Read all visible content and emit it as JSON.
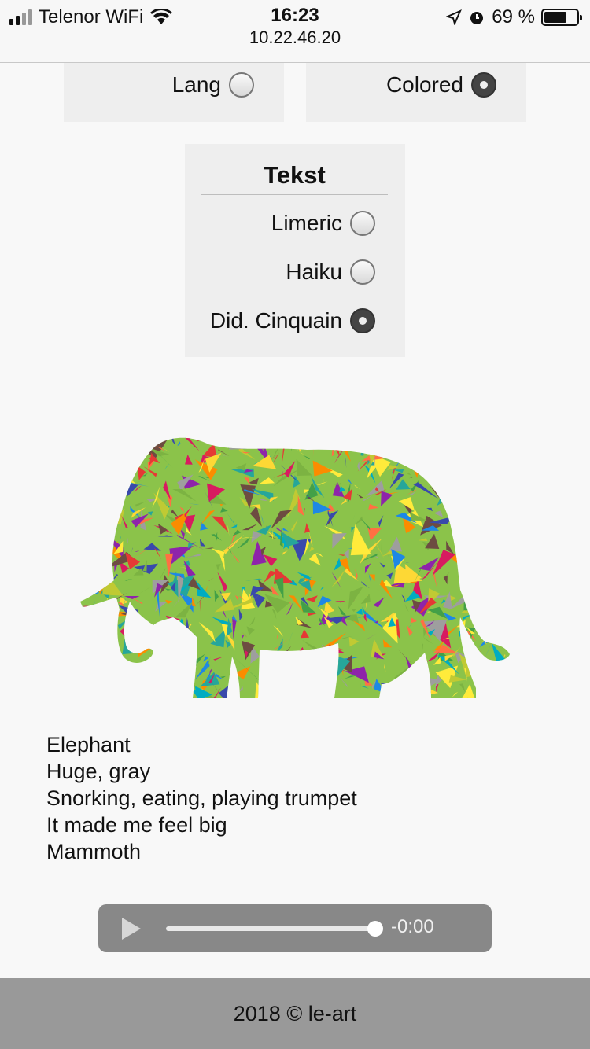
{
  "status_bar": {
    "carrier": "Telenor WiFi",
    "time": "16:23",
    "url": "10.22.46.20",
    "battery_percent": "69 %",
    "battery_level": 0.69
  },
  "options": {
    "lang": {
      "label": "Lang",
      "checked": false
    },
    "colored": {
      "label": "Colored",
      "checked": true
    }
  },
  "tekst": {
    "title": "Tekst",
    "items": [
      {
        "label": "Limeric",
        "checked": false
      },
      {
        "label": "Haiku",
        "checked": false
      },
      {
        "label": "Did. Cinquain",
        "checked": true
      }
    ]
  },
  "image": {
    "subject": "elephant",
    "style": "colored-mosaic"
  },
  "poem": {
    "lines": [
      "Elephant",
      "Huge, gray",
      "Snorking, eating, playing trumpet",
      "It made me feel big",
      "Mammoth"
    ]
  },
  "audio": {
    "time": "-0:00",
    "progress": 1.0
  },
  "footer": {
    "text": "2018 © le-art"
  },
  "colors": {
    "accent_gray": "#888888",
    "footer_bg": "#999999",
    "box_bg": "#eeeeee"
  }
}
